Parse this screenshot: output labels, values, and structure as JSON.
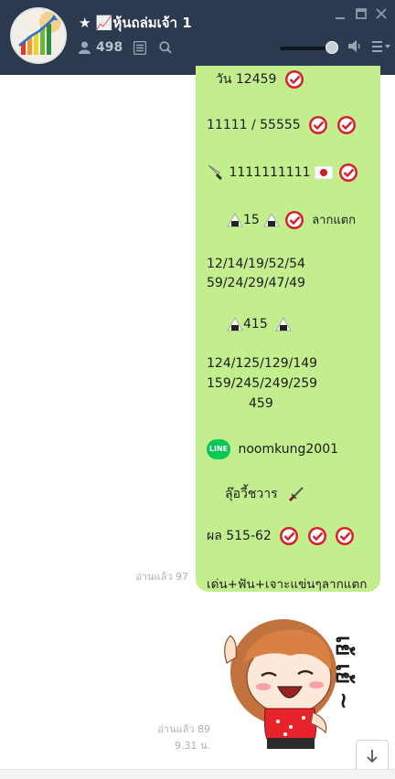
{
  "header": {
    "title": "★ 📈หุ้นถล่มเจ้า 1",
    "member_count": "498"
  },
  "messages": {
    "line1": "วัน  12459",
    "line2": "11111 / 55555",
    "line3": "1111111111",
    "line4": "15",
    "line4_note": "ลากแตก",
    "line5a": "12/14/19/52/54",
    "line5b": "59/24/29/47/49",
    "line6": "415",
    "line7a": "124/125/129/149",
    "line7b": "159/245/249/259",
    "line7c": "459",
    "line_logo": "LINE",
    "line8": "noomkung2001",
    "line9": "ลุ๊อวี้ชวาร",
    "line10": "ผล 515-62",
    "line11": "เด่น+ฟัน+เจาะแข่นๆลากแตก",
    "read1": "อ่านแล้ว 97",
    "read2": "อ่านแล้ว 89",
    "time2": "9.31 น.",
    "sticker_text": "เย้ เย้ ~"
  },
  "colors": {
    "header_bg": "#2c3a4f",
    "bubble_bg": "#c2ee8d",
    "check_red": "#d8202c"
  }
}
